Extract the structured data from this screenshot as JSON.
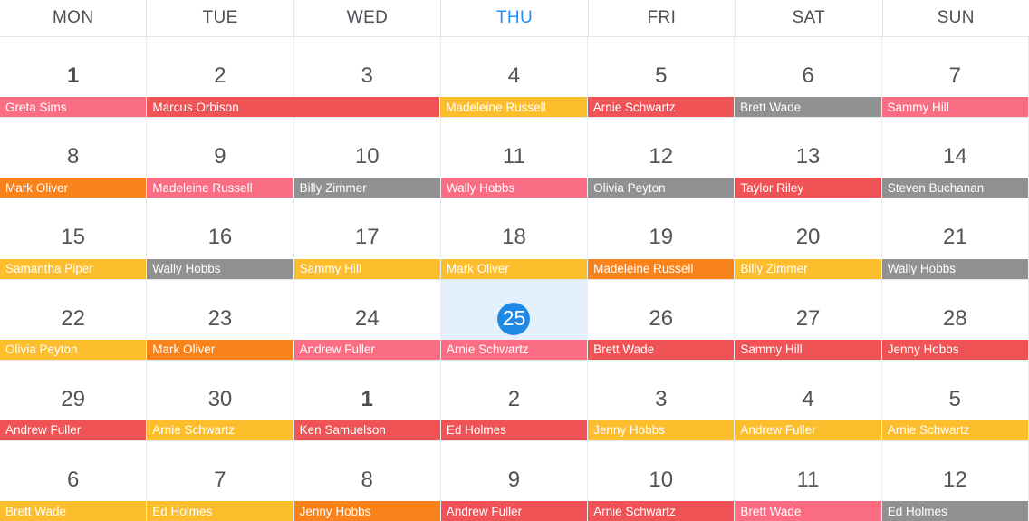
{
  "colors": {
    "pink": "#fb6d82",
    "red": "#ef5356",
    "amber": "#fcbe2d",
    "orange": "#f9821a",
    "gray": "#919191",
    "today_blue": "#1e88e5",
    "today_bg": "#e4f1fd",
    "today_header": "#1e90ff",
    "grid_line": "#e4e8ed",
    "day_text": "#50555a"
  },
  "header": {
    "weekdays": [
      {
        "label": "MON",
        "is_today": false
      },
      {
        "label": "TUE",
        "is_today": false
      },
      {
        "label": "WED",
        "is_today": false
      },
      {
        "label": "THU",
        "is_today": true
      },
      {
        "label": "FRI",
        "is_today": false
      },
      {
        "label": "SAT",
        "is_today": false
      },
      {
        "label": "SUN",
        "is_today": false
      }
    ]
  },
  "weeks": [
    {
      "days": [
        {
          "number": "1",
          "first_of_month": true,
          "is_today": false
        },
        {
          "number": "2",
          "first_of_month": false,
          "is_today": false
        },
        {
          "number": "3",
          "first_of_month": false,
          "is_today": false
        },
        {
          "number": "4",
          "first_of_month": false,
          "is_today": false
        },
        {
          "number": "5",
          "first_of_month": false,
          "is_today": false
        },
        {
          "number": "6",
          "first_of_month": false,
          "is_today": false
        },
        {
          "number": "7",
          "first_of_month": false,
          "is_today": false
        }
      ],
      "events": [
        {
          "title": "Greta Sims",
          "color": "#fb6d82",
          "span": 1
        },
        {
          "title": "Marcus Orbison",
          "color": "#ef5356",
          "span": 2
        },
        {
          "title": "Madeleine Russell",
          "color": "#fcbe2d",
          "span": 1
        },
        {
          "title": "Arnie Schwartz",
          "color": "#ef5356",
          "span": 1
        },
        {
          "title": "Brett Wade",
          "color": "#919191",
          "span": 1
        },
        {
          "title": "Sammy Hill",
          "color": "#fb6d82",
          "span": 1
        }
      ]
    },
    {
      "days": [
        {
          "number": "8",
          "first_of_month": false,
          "is_today": false
        },
        {
          "number": "9",
          "first_of_month": false,
          "is_today": false
        },
        {
          "number": "10",
          "first_of_month": false,
          "is_today": false
        },
        {
          "number": "11",
          "first_of_month": false,
          "is_today": false
        },
        {
          "number": "12",
          "first_of_month": false,
          "is_today": false
        },
        {
          "number": "13",
          "first_of_month": false,
          "is_today": false
        },
        {
          "number": "14",
          "first_of_month": false,
          "is_today": false
        }
      ],
      "events": [
        {
          "title": "Mark Oliver",
          "color": "#f9821a",
          "span": 1
        },
        {
          "title": "Madeleine Russell",
          "color": "#fb6d82",
          "span": 1
        },
        {
          "title": "Billy Zimmer",
          "color": "#919191",
          "span": 1
        },
        {
          "title": "Wally Hobbs",
          "color": "#fb6d82",
          "span": 1
        },
        {
          "title": "Olivia Peyton",
          "color": "#919191",
          "span": 1
        },
        {
          "title": "Taylor Riley",
          "color": "#ef5356",
          "span": 1
        },
        {
          "title": "Steven Buchanan",
          "color": "#919191",
          "span": 1
        }
      ]
    },
    {
      "days": [
        {
          "number": "15",
          "first_of_month": false,
          "is_today": false
        },
        {
          "number": "16",
          "first_of_month": false,
          "is_today": false
        },
        {
          "number": "17",
          "first_of_month": false,
          "is_today": false
        },
        {
          "number": "18",
          "first_of_month": false,
          "is_today": false
        },
        {
          "number": "19",
          "first_of_month": false,
          "is_today": false
        },
        {
          "number": "20",
          "first_of_month": false,
          "is_today": false
        },
        {
          "number": "21",
          "first_of_month": false,
          "is_today": false
        }
      ],
      "events": [
        {
          "title": "Samantha Piper",
          "color": "#fcbe2d",
          "span": 1
        },
        {
          "title": "Wally Hobbs",
          "color": "#919191",
          "span": 1
        },
        {
          "title": "Sammy Hill",
          "color": "#fcbe2d",
          "span": 1
        },
        {
          "title": "Mark Oliver",
          "color": "#fcbe2d",
          "span": 1
        },
        {
          "title": "Madeleine Russell",
          "color": "#f9821a",
          "span": 1
        },
        {
          "title": "Billy Zimmer",
          "color": "#fcbe2d",
          "span": 1
        },
        {
          "title": "Wally Hobbs",
          "color": "#919191",
          "span": 1
        }
      ]
    },
    {
      "days": [
        {
          "number": "22",
          "first_of_month": false,
          "is_today": false
        },
        {
          "number": "23",
          "first_of_month": false,
          "is_today": false
        },
        {
          "number": "24",
          "first_of_month": false,
          "is_today": false
        },
        {
          "number": "25",
          "first_of_month": false,
          "is_today": true
        },
        {
          "number": "26",
          "first_of_month": false,
          "is_today": false
        },
        {
          "number": "27",
          "first_of_month": false,
          "is_today": false
        },
        {
          "number": "28",
          "first_of_month": false,
          "is_today": false
        }
      ],
      "events": [
        {
          "title": "Olivia Peyton",
          "color": "#fcbe2d",
          "span": 1
        },
        {
          "title": "Mark Oliver",
          "color": "#f9821a",
          "span": 1
        },
        {
          "title": "Andrew Fuller",
          "color": "#fb6d82",
          "span": 1
        },
        {
          "title": "Arnie Schwartz",
          "color": "#fb6d82",
          "span": 1
        },
        {
          "title": "Brett Wade",
          "color": "#ef5356",
          "span": 1
        },
        {
          "title": "Sammy Hill",
          "color": "#ef5356",
          "span": 1
        },
        {
          "title": "Jenny Hobbs",
          "color": "#ef5356",
          "span": 1
        }
      ]
    },
    {
      "days": [
        {
          "number": "29",
          "first_of_month": false,
          "is_today": false
        },
        {
          "number": "30",
          "first_of_month": false,
          "is_today": false
        },
        {
          "number": "1",
          "first_of_month": true,
          "is_today": false
        },
        {
          "number": "2",
          "first_of_month": false,
          "is_today": false
        },
        {
          "number": "3",
          "first_of_month": false,
          "is_today": false
        },
        {
          "number": "4",
          "first_of_month": false,
          "is_today": false
        },
        {
          "number": "5",
          "first_of_month": false,
          "is_today": false
        }
      ],
      "events": [
        {
          "title": "Andrew Fuller",
          "color": "#ef5356",
          "span": 1
        },
        {
          "title": "Arnie Schwartz",
          "color": "#fcbe2d",
          "span": 1
        },
        {
          "title": "Ken Samuelson",
          "color": "#ef5356",
          "span": 1
        },
        {
          "title": "Ed Holmes",
          "color": "#ef5356",
          "span": 1
        },
        {
          "title": "Jenny Hobbs",
          "color": "#fcbe2d",
          "span": 1
        },
        {
          "title": "Andrew Fuller",
          "color": "#fcbe2d",
          "span": 1
        },
        {
          "title": "Arnie Schwartz",
          "color": "#fcbe2d",
          "span": 1
        }
      ]
    },
    {
      "days": [
        {
          "number": "6",
          "first_of_month": false,
          "is_today": false
        },
        {
          "number": "7",
          "first_of_month": false,
          "is_today": false
        },
        {
          "number": "8",
          "first_of_month": false,
          "is_today": false
        },
        {
          "number": "9",
          "first_of_month": false,
          "is_today": false
        },
        {
          "number": "10",
          "first_of_month": false,
          "is_today": false
        },
        {
          "number": "11",
          "first_of_month": false,
          "is_today": false
        },
        {
          "number": "12",
          "first_of_month": false,
          "is_today": false
        }
      ],
      "events": [
        {
          "title": "Brett Wade",
          "color": "#fcbe2d",
          "span": 1
        },
        {
          "title": "Ed Holmes",
          "color": "#fcbe2d",
          "span": 1
        },
        {
          "title": "Jenny Hobbs",
          "color": "#f9821a",
          "span": 1
        },
        {
          "title": "Andrew Fuller",
          "color": "#ef5356",
          "span": 1
        },
        {
          "title": "Arnie Schwartz",
          "color": "#ef5356",
          "span": 1
        },
        {
          "title": "Brett Wade",
          "color": "#fb6d82",
          "span": 1
        },
        {
          "title": "Ed Holmes",
          "color": "#919191",
          "span": 1
        }
      ]
    }
  ]
}
